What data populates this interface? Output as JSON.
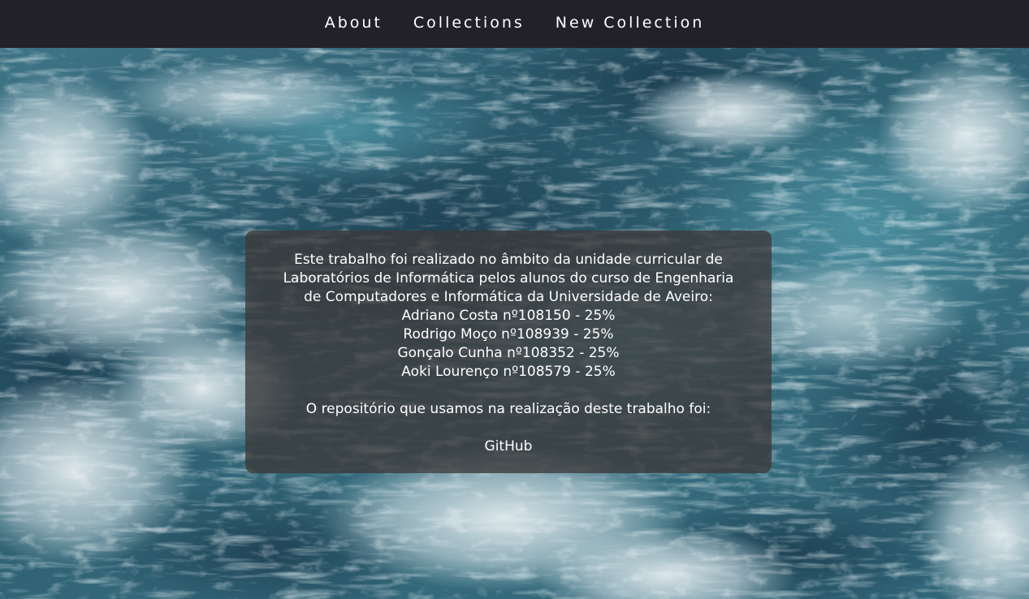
{
  "nav": {
    "items": [
      {
        "label": "About"
      },
      {
        "label": "Collections"
      },
      {
        "label": "New Collection"
      }
    ]
  },
  "background": {
    "image": "ocean-waves",
    "base_color": "#2d5a6e",
    "foam_color": "#dbe7ec"
  },
  "info": {
    "intro_line_1": "Este trabalho foi realizado no âmbito da unidade curricular de",
    "intro_line_2": "Laboratórios de Informática pelos alunos do curso de Engenharia",
    "intro_line_3": "de Computadores e Informática da Universidade de Aveiro:",
    "members": [
      "Adriano Costa nº108150 - 25%",
      "Rodrigo Moço nº108939 - 25%",
      "Gonçalo Cunha nº108352 - 25%",
      "Aoki Lourenço nº108579 - 25%"
    ],
    "repo_text": "O repositório que usamos na realização deste trabalho foi:",
    "repo_link": "GitHub"
  }
}
